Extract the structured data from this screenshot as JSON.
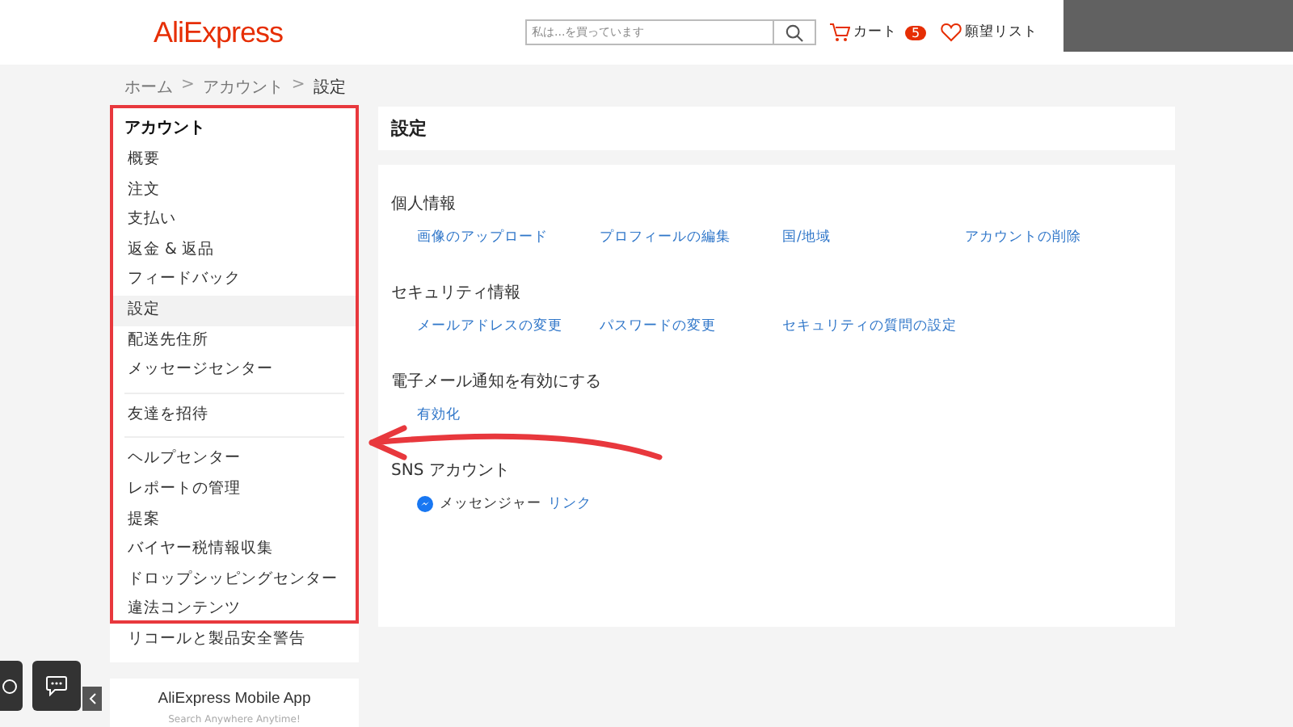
{
  "header": {
    "logo": "AliExpress",
    "search": {
      "placeholder": "私は...を買っています"
    },
    "cart": {
      "label": "カート",
      "count": "5"
    },
    "wishlist": {
      "label": "願望リスト"
    }
  },
  "breadcrumb": [
    {
      "label": "ホーム"
    },
    {
      "label": "アカウント"
    },
    {
      "label": "設定"
    }
  ],
  "breadcrumb_separator": ">",
  "sidebar": {
    "title": "アカウント",
    "groups": [
      [
        {
          "label": "概要",
          "selected": false
        },
        {
          "label": "注文",
          "selected": false
        },
        {
          "label": "支払い",
          "selected": false
        },
        {
          "label": "返金 & 返品",
          "selected": false
        },
        {
          "label": "フィードバック",
          "selected": false
        },
        {
          "label": "設定",
          "selected": true
        },
        {
          "label": "配送先住所",
          "selected": false
        },
        {
          "label": "メッセージセンター",
          "selected": false
        }
      ],
      [
        {
          "label": "友達を招待",
          "selected": false
        }
      ],
      [
        {
          "label": "ヘルプセンター",
          "selected": false
        },
        {
          "label": "レポートの管理",
          "selected": false
        },
        {
          "label": "提案",
          "selected": false
        },
        {
          "label": "バイヤー税情報収集",
          "selected": false
        },
        {
          "label": "ドロップシッピングセンター",
          "selected": false
        },
        {
          "label": "違法コンテンツ",
          "selected": false
        },
        {
          "label": "リコールと製品安全警告",
          "selected": false
        }
      ]
    ]
  },
  "app_card": {
    "title": "AliExpress Mobile App",
    "subtitle": "Search Anywhere Anytime!"
  },
  "page_title": "設定",
  "sections": [
    {
      "title": "個人情報",
      "links": [
        {
          "label": "画像のアップロード"
        },
        {
          "label": "プロフィールの編集"
        },
        {
          "label": "国/地域"
        },
        {
          "label": "アカウントの削除"
        }
      ]
    },
    {
      "title": "セキュリティ情報",
      "links": [
        {
          "label": "メールアドレスの変更"
        },
        {
          "label": "パスワードの変更"
        },
        {
          "label": "セキュリティの質問の設定"
        }
      ]
    },
    {
      "title": "電子メール通知を有効にする",
      "links": [
        {
          "label": "有効化"
        }
      ]
    },
    {
      "title": "SNS アカウント",
      "social": [
        {
          "name": "メッセンジャー",
          "action": "リンク"
        }
      ]
    }
  ]
}
